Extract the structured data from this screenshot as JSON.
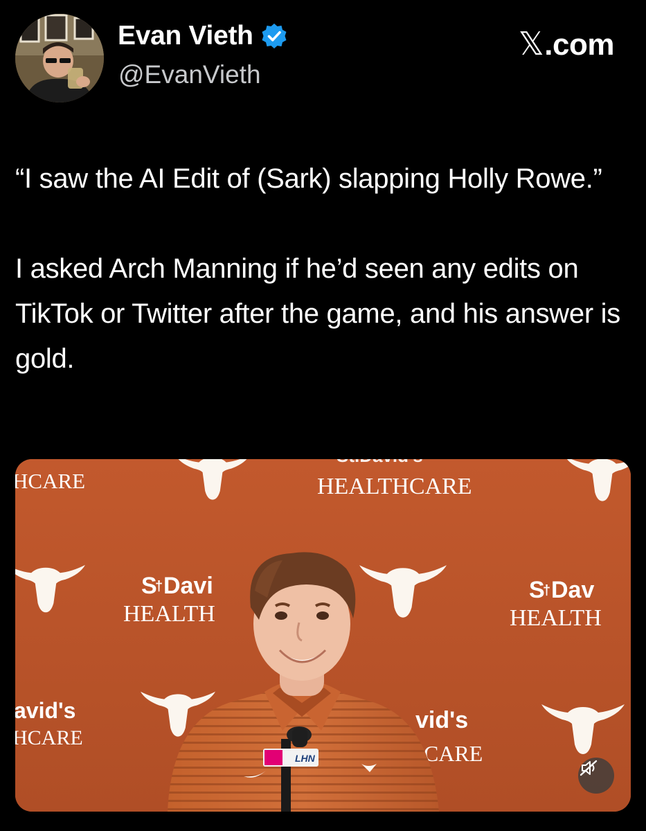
{
  "author": {
    "name": "Evan Vieth",
    "handle": "@EvanVieth",
    "verified": true,
    "verified_color": "#1d9bf0"
  },
  "brand": {
    "glyph": "𝕏",
    "suffix": ".com"
  },
  "tweet": {
    "paragraph_1": "“I saw the AI Edit of (Sark) slapping Holly Rowe.”",
    "paragraph_2": "I asked Arch Manning if he’d seen any edits on TikTok or Twitter after the game, and his answer is gold."
  },
  "media": {
    "type": "video",
    "backdrop_color": "#b9552c",
    "backdrop_texts": {
      "sponsor_short": "HCARE",
      "sponsor_full": "HEALTHCARE",
      "sponsor_top_partial": "St.David's",
      "stdavid_left": "S",
      "stdavid_left_rest": "Davi",
      "health_left": "HEALTH",
      "stdavid_right": "S",
      "stdavid_right_rest": "Dav",
      "health_right": "HEALTH",
      "avids": "avid's",
      "hcare_bottom": "HCARE",
      "vids": "vid's",
      "care_bottom": "CARE"
    },
    "mic_flag_label": "LHN",
    "mute_icon": "speaker-muted-icon"
  }
}
